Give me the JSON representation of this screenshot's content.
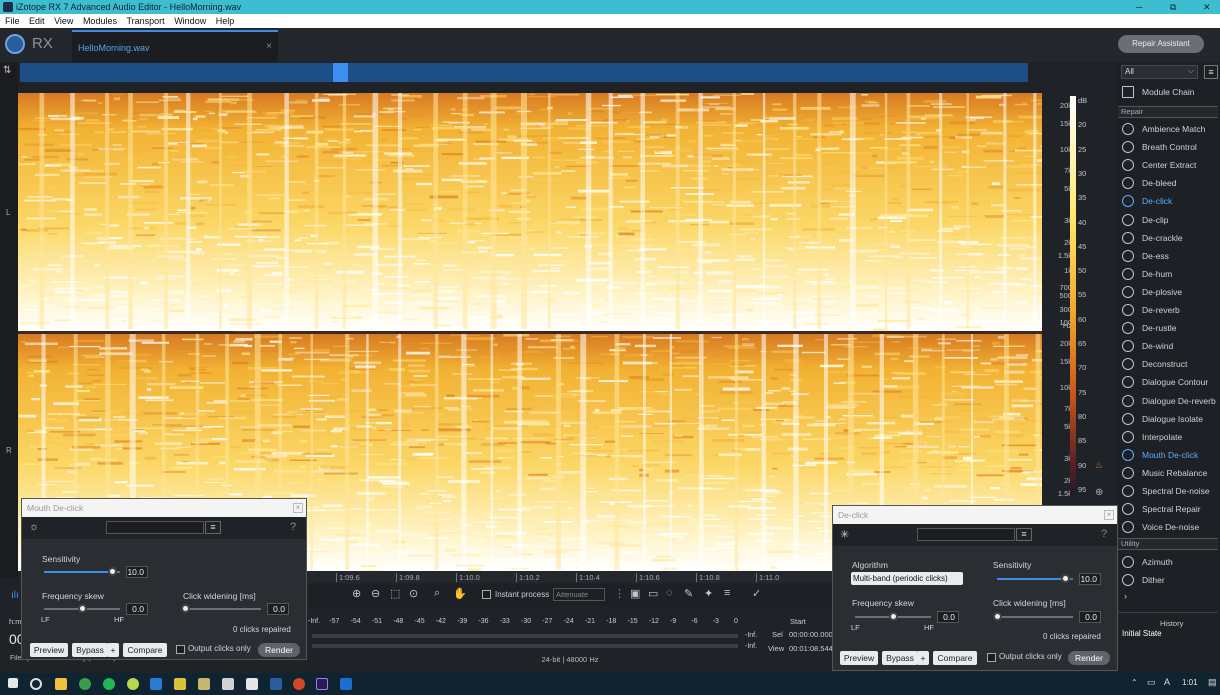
{
  "window": {
    "title": "iZotope RX 7 Advanced Audio Editor - HelloMorning.wav",
    "minimize": "─",
    "restore": "⧉",
    "close": "✕"
  },
  "menu": [
    "File",
    "Edit",
    "View",
    "Modules",
    "Transport",
    "Window",
    "Help"
  ],
  "header": {
    "app_logo_text": "RX",
    "file_tab": "HelloMorning.wav",
    "close": "×",
    "repair_assistant": "Repair Assistant"
  },
  "channels": {
    "left": "L",
    "right": "R"
  },
  "freq_ticks": [
    "20k",
    "15k",
    "10k",
    "7k",
    "5k",
    "3k",
    "2k",
    "1.5k",
    "1k",
    "700",
    "500",
    "300",
    "100",
    "Hz",
    "20k",
    "15k",
    "10k",
    "7k",
    "5k",
    "3k",
    "2k",
    "1.5k",
    "1k",
    "700",
    "500",
    "300",
    "100",
    "1.5k"
  ],
  "db_ticks": [
    "dB",
    "20",
    "25",
    "30",
    "35",
    "40",
    "45",
    "50",
    "55",
    "60",
    "65",
    "70",
    "75",
    "80",
    "85",
    "90",
    "95",
    "100"
  ],
  "timeline": [
    "1:09.6",
    "1:09.8",
    "1:10.0",
    "1:10.2",
    "1:10.4",
    "1:10.6",
    "1:10.8",
    "1:11.0"
  ],
  "toolbar": {
    "instant_process": "Instant process",
    "attenuate": "Attenuate"
  },
  "meter_ticks": [
    "-Inf.",
    "-57",
    "-54",
    "-51",
    "-48",
    "-45",
    "-42",
    "-39",
    "-36",
    "-33",
    "-30",
    "-27",
    "-24",
    "-21",
    "-18",
    "-15",
    "-12",
    "-9",
    "-6",
    "-3",
    "0"
  ],
  "meter_inf": "-Inf.",
  "selection": {
    "start_label": "Start",
    "sel_label": "Sel",
    "sel_value": "00:00:00.000",
    "view_label": "View",
    "view_value": "00:01:08.544"
  },
  "status": {
    "format": "24-bit | 48000 Hz",
    "left_text": "File opened successfully (532 ms)",
    "time_label": "h:m",
    "time_value": "00"
  },
  "sidebar": {
    "filter": "All",
    "module_chain": "Module Chain",
    "repair_section": "Repair",
    "repair_items": [
      "Ambience Match",
      "Breath Control",
      "Center Extract",
      "De-bleed",
      "De-click",
      "De-clip",
      "De-crackle",
      "De-ess",
      "De-hum",
      "De-plosive",
      "De-reverb",
      "De-rustle",
      "De-wind",
      "Deconstruct",
      "Dialogue Contour",
      "Dialogue De-reverb",
      "Dialogue Isolate",
      "Interpolate",
      "Mouth De-click",
      "Music Rebalance",
      "Spectral De-noise",
      "Spectral Repair",
      "Voice De-noise"
    ],
    "utility_section": "Utility",
    "utility_items": [
      "Azimuth",
      "Dither"
    ],
    "history_title": "History",
    "history_item": "Initial State"
  },
  "mouth_declick": {
    "title": "Mouth De-click",
    "help": "?",
    "sensitivity_label": "Sensitivity",
    "sensitivity_value": "10.0",
    "sensitivity_level": 0.9,
    "freq_skew_label": "Frequency skew",
    "freq_skew_value": "0.0",
    "freq_skew_level": 0.5,
    "lf": "LF",
    "hf": "HF",
    "click_widening_label": "Click widening [ms]",
    "click_widening_value": "0.0",
    "click_widening_level": 0.0,
    "clicks_repaired": "0 clicks repaired",
    "preview": "Preview",
    "bypass": "Bypass",
    "plus": "+",
    "compare": "Compare",
    "output_clicks_only": "Output clicks only",
    "render": "Render"
  },
  "declick": {
    "title": "De-click",
    "help": "?",
    "algorithm_label": "Algorithm",
    "algorithm_value": "Multi-band (periodic clicks)",
    "sensitivity_label": "Sensitivity",
    "sensitivity_value": "10.0",
    "sensitivity_level": 0.9,
    "freq_skew_label": "Frequency skew",
    "freq_skew_value": "0.0",
    "freq_skew_level": 0.5,
    "lf": "LF",
    "hf": "HF",
    "click_widening_label": "Click widening [ms]",
    "click_widening_value": "0.0",
    "click_widening_level": 0.0,
    "clicks_repaired": "0 clicks repaired",
    "preview": "Preview",
    "bypass": "Bypass",
    "plus": "+",
    "compare": "Compare",
    "output_clicks_only": "Output clicks only",
    "render": "Render"
  },
  "taskbar": {
    "time": "1:01"
  },
  "colors": {
    "accent": "#3a8ff0",
    "titlebar": "#3cbdd0",
    "spectrum_hot": "#ffffff",
    "spectrum_warm": "#f7c64a",
    "spectrum_cool": "#c9541b"
  }
}
